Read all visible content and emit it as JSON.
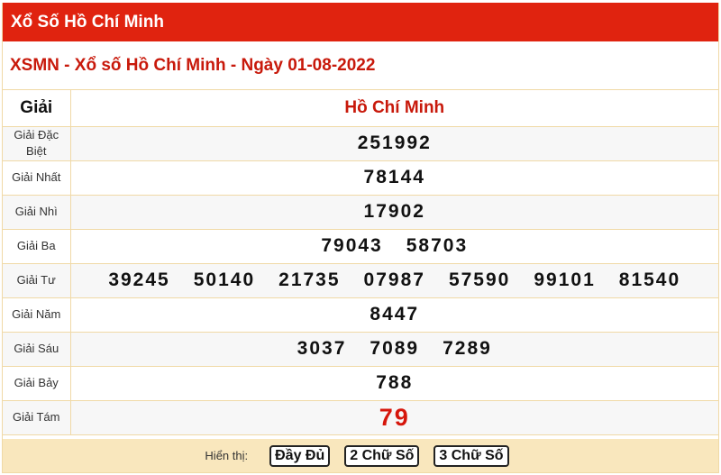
{
  "header": {
    "title": "Xổ Số Hồ Chí Minh"
  },
  "subtitle": "XSMN - Xổ số Hồ Chí Minh - Ngày 01-08-2022",
  "table": {
    "col_prize": "Giải",
    "col_province": "Hồ Chí Minh",
    "rows": [
      {
        "label": "Giải Đặc Biệt",
        "numbers": [
          "251992"
        ]
      },
      {
        "label": "Giải Nhất",
        "numbers": [
          "78144"
        ]
      },
      {
        "label": "Giải Nhì",
        "numbers": [
          "17902"
        ]
      },
      {
        "label": "Giải Ba",
        "numbers": [
          "79043",
          "58703"
        ]
      },
      {
        "label": "Giải Tư",
        "numbers": [
          "39245",
          "50140",
          "21735",
          "07987",
          "57590",
          "99101",
          "81540"
        ]
      },
      {
        "label": "Giải Năm",
        "numbers": [
          "8447"
        ]
      },
      {
        "label": "Giải Sáu",
        "numbers": [
          "3037",
          "7089",
          "7289"
        ]
      },
      {
        "label": "Giải Bảy",
        "numbers": [
          "788"
        ]
      },
      {
        "label": "Giải Tám",
        "numbers": [
          "79"
        ]
      }
    ]
  },
  "footer": {
    "label": "Hiển thị:",
    "buttons": [
      "Đầy Đủ",
      "2 Chữ Số",
      "3 Chữ Số"
    ]
  },
  "colors": {
    "header_bg": "#e0230f",
    "title_red": "#c8190b",
    "footer_bg": "#f9e7bd",
    "border": "#f0d9a6"
  }
}
